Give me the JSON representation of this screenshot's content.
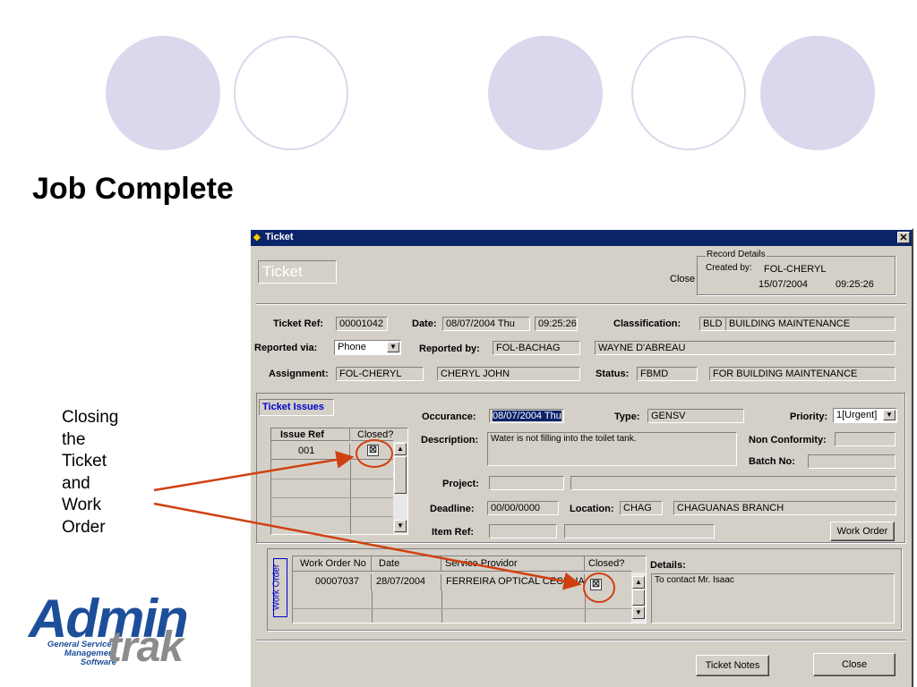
{
  "slide": {
    "title": "Job Complete",
    "callout_lines": [
      "Closing",
      "the",
      "Ticket",
      "and",
      "Work",
      "Order"
    ]
  },
  "logo": {
    "brand_main": "Adm",
    "brand_i": "i",
    "brand_n": "n",
    "brand_trak": "trak",
    "subtitle_lines": [
      "General Services",
      "Management",
      "Software"
    ]
  },
  "window": {
    "title": "Ticket",
    "heading": "Ticket",
    "close_link": "Close",
    "record_details": {
      "legend": "Record Details",
      "created_by_label": "Created by:",
      "created_by": "FOL-CHERYL",
      "date": "15/07/2004",
      "time": "09:25:26"
    },
    "ticket_ref_label": "Ticket Ref:",
    "ticket_ref": "00001042",
    "date_label": "Date:",
    "date": "08/07/2004 Thu",
    "time": "09:25:26",
    "classification_label": "Classification:",
    "classification_code": "BLD",
    "classification_name": "BUILDING MAINTENANCE",
    "reported_via_label": "Reported via:",
    "reported_via": "Phone",
    "reported_by_label": "Reported by:",
    "reported_by_code": "FOL-BACHAG",
    "reported_by_name": "WAYNE D'ABREAU",
    "assignment_label": "Assignment:",
    "assignment_code": "FOL-CHERYL",
    "assignment_name": "CHERYL JOHN",
    "status_label": "Status:",
    "status_code": "FBMD",
    "status_name": "FOR BUILDING MAINTENANCE",
    "issues": {
      "tab_label": "Ticket Issues",
      "headers": [
        "Issue Ref",
        "Closed?"
      ],
      "rows": [
        {
          "ref": "001",
          "closed": "☒"
        }
      ],
      "occurance_label": "Occurance:",
      "occurance": "08/07/2004 Thu",
      "type_label": "Type:",
      "type": "GENSV",
      "priority_label": "Priority:",
      "priority": "1[Urgent]",
      "description_label": "Description:",
      "description": "Water is not filling into the toilet tank.",
      "non_conformity_label": "Non Conformity:",
      "batch_no_label": "Batch No:",
      "project_label": "Project:",
      "deadline_label": "Deadline:",
      "deadline": "00/00/0000",
      "location_label": "Location:",
      "location_code": "CHAG",
      "location_name": "CHAGUANAS BRANCH",
      "item_ref_label": "Item Ref:",
      "work_order_button": "Work Order"
    },
    "work_orders": {
      "side_label": "Work Order",
      "headers": [
        "Work Order No",
        "Date",
        "Service Providor",
        "Closed?"
      ],
      "rows": [
        {
          "no": "00007037",
          "date": "28/07/2004",
          "provider": "FERREIRA OPTICAL CECELIA",
          "closed": "☒"
        }
      ],
      "details_label": "Details:",
      "details": "To contact Mr. Isaac"
    },
    "ticket_notes_button": "Ticket Notes",
    "close_button": "Close"
  },
  "colors": {
    "circle": "#d9d8ec",
    "accent_arrow": "#d04010",
    "titlebar": "#0a246a",
    "window_face": "#d4d0c8"
  }
}
